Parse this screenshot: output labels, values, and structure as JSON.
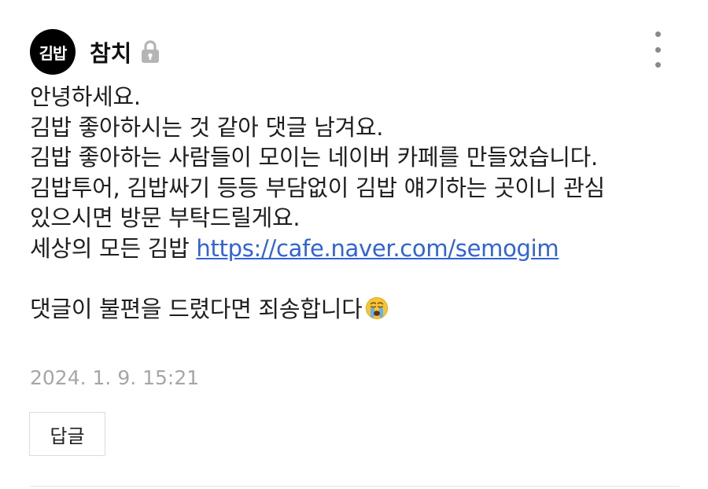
{
  "comment": {
    "avatar_text": "김밥",
    "author": "참치",
    "lock_icon": "lock-icon",
    "more_icon": "more-vertical-icon",
    "lines": [
      "안녕하세요.",
      "김밥 좋아하시는 것 같아 댓글 남겨요.",
      "김밥 좋아하는 사람들이 모이는 네이버 카페를 만들었습니다.",
      "김밥투어, 김밥싸기 등등 부담없이 김밥 얘기하는 곳이니 관심",
      "있으시면 방문 부탁드릴게요."
    ],
    "link_prefix": "세상의 모든 김밥 ",
    "link_text": "https://cafe.naver.com/semogim",
    "apology": "댓글이 불편을 드렸다면 죄송합니다",
    "emoji": "crying-face-emoji",
    "timestamp": "2024. 1. 9. 15:21",
    "reply_label": "답글"
  }
}
